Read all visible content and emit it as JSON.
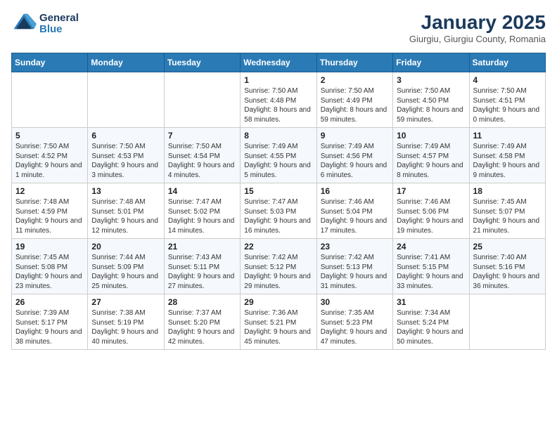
{
  "header": {
    "logo_general": "General",
    "logo_blue": "Blue",
    "month_title": "January 2025",
    "location": "Giurgiu, Giurgiu County, Romania"
  },
  "weekdays": [
    "Sunday",
    "Monday",
    "Tuesday",
    "Wednesday",
    "Thursday",
    "Friday",
    "Saturday"
  ],
  "weeks": [
    [
      {
        "day": "",
        "content": ""
      },
      {
        "day": "",
        "content": ""
      },
      {
        "day": "",
        "content": ""
      },
      {
        "day": "1",
        "content": "Sunrise: 7:50 AM\nSunset: 4:48 PM\nDaylight: 8 hours and 58 minutes."
      },
      {
        "day": "2",
        "content": "Sunrise: 7:50 AM\nSunset: 4:49 PM\nDaylight: 8 hours and 59 minutes."
      },
      {
        "day": "3",
        "content": "Sunrise: 7:50 AM\nSunset: 4:50 PM\nDaylight: 8 hours and 59 minutes."
      },
      {
        "day": "4",
        "content": "Sunrise: 7:50 AM\nSunset: 4:51 PM\nDaylight: 9 hours and 0 minutes."
      }
    ],
    [
      {
        "day": "5",
        "content": "Sunrise: 7:50 AM\nSunset: 4:52 PM\nDaylight: 9 hours and 1 minute."
      },
      {
        "day": "6",
        "content": "Sunrise: 7:50 AM\nSunset: 4:53 PM\nDaylight: 9 hours and 3 minutes."
      },
      {
        "day": "7",
        "content": "Sunrise: 7:50 AM\nSunset: 4:54 PM\nDaylight: 9 hours and 4 minutes."
      },
      {
        "day": "8",
        "content": "Sunrise: 7:49 AM\nSunset: 4:55 PM\nDaylight: 9 hours and 5 minutes."
      },
      {
        "day": "9",
        "content": "Sunrise: 7:49 AM\nSunset: 4:56 PM\nDaylight: 9 hours and 6 minutes."
      },
      {
        "day": "10",
        "content": "Sunrise: 7:49 AM\nSunset: 4:57 PM\nDaylight: 9 hours and 8 minutes."
      },
      {
        "day": "11",
        "content": "Sunrise: 7:49 AM\nSunset: 4:58 PM\nDaylight: 9 hours and 9 minutes."
      }
    ],
    [
      {
        "day": "12",
        "content": "Sunrise: 7:48 AM\nSunset: 4:59 PM\nDaylight: 9 hours and 11 minutes."
      },
      {
        "day": "13",
        "content": "Sunrise: 7:48 AM\nSunset: 5:01 PM\nDaylight: 9 hours and 12 minutes."
      },
      {
        "day": "14",
        "content": "Sunrise: 7:47 AM\nSunset: 5:02 PM\nDaylight: 9 hours and 14 minutes."
      },
      {
        "day": "15",
        "content": "Sunrise: 7:47 AM\nSunset: 5:03 PM\nDaylight: 9 hours and 16 minutes."
      },
      {
        "day": "16",
        "content": "Sunrise: 7:46 AM\nSunset: 5:04 PM\nDaylight: 9 hours and 17 minutes."
      },
      {
        "day": "17",
        "content": "Sunrise: 7:46 AM\nSunset: 5:06 PM\nDaylight: 9 hours and 19 minutes."
      },
      {
        "day": "18",
        "content": "Sunrise: 7:45 AM\nSunset: 5:07 PM\nDaylight: 9 hours and 21 minutes."
      }
    ],
    [
      {
        "day": "19",
        "content": "Sunrise: 7:45 AM\nSunset: 5:08 PM\nDaylight: 9 hours and 23 minutes."
      },
      {
        "day": "20",
        "content": "Sunrise: 7:44 AM\nSunset: 5:09 PM\nDaylight: 9 hours and 25 minutes."
      },
      {
        "day": "21",
        "content": "Sunrise: 7:43 AM\nSunset: 5:11 PM\nDaylight: 9 hours and 27 minutes."
      },
      {
        "day": "22",
        "content": "Sunrise: 7:42 AM\nSunset: 5:12 PM\nDaylight: 9 hours and 29 minutes."
      },
      {
        "day": "23",
        "content": "Sunrise: 7:42 AM\nSunset: 5:13 PM\nDaylight: 9 hours and 31 minutes."
      },
      {
        "day": "24",
        "content": "Sunrise: 7:41 AM\nSunset: 5:15 PM\nDaylight: 9 hours and 33 minutes."
      },
      {
        "day": "25",
        "content": "Sunrise: 7:40 AM\nSunset: 5:16 PM\nDaylight: 9 hours and 36 minutes."
      }
    ],
    [
      {
        "day": "26",
        "content": "Sunrise: 7:39 AM\nSunset: 5:17 PM\nDaylight: 9 hours and 38 minutes."
      },
      {
        "day": "27",
        "content": "Sunrise: 7:38 AM\nSunset: 5:19 PM\nDaylight: 9 hours and 40 minutes."
      },
      {
        "day": "28",
        "content": "Sunrise: 7:37 AM\nSunset: 5:20 PM\nDaylight: 9 hours and 42 minutes."
      },
      {
        "day": "29",
        "content": "Sunrise: 7:36 AM\nSunset: 5:21 PM\nDaylight: 9 hours and 45 minutes."
      },
      {
        "day": "30",
        "content": "Sunrise: 7:35 AM\nSunset: 5:23 PM\nDaylight: 9 hours and 47 minutes."
      },
      {
        "day": "31",
        "content": "Sunrise: 7:34 AM\nSunset: 5:24 PM\nDaylight: 9 hours and 50 minutes."
      },
      {
        "day": "",
        "content": ""
      }
    ]
  ]
}
